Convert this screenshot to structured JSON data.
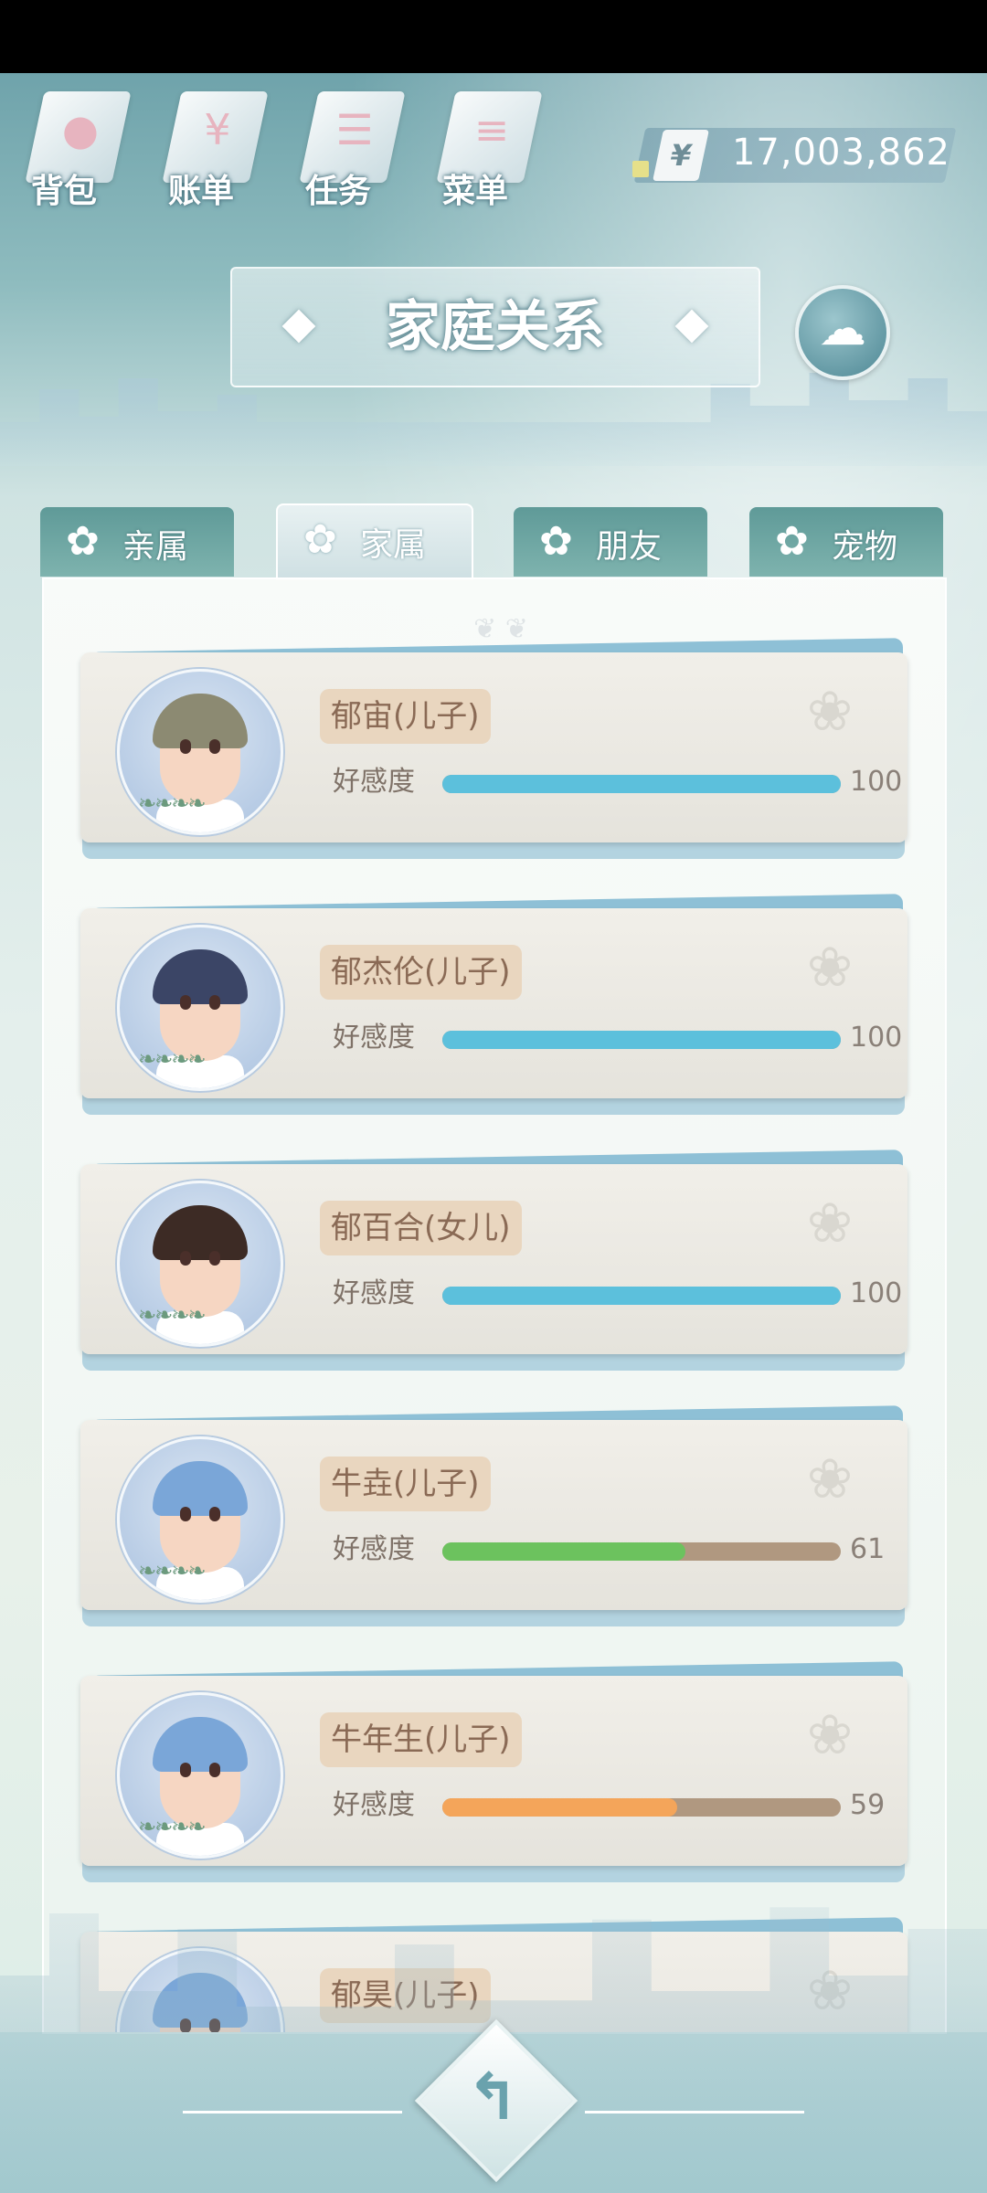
{
  "top_menu": [
    {
      "label": "背包",
      "icon": "backpack-icon",
      "glyph": "●"
    },
    {
      "label": "账单",
      "icon": "bill-icon",
      "glyph": "¥"
    },
    {
      "label": "任务",
      "icon": "task-icon",
      "glyph": "☰"
    },
    {
      "label": "菜单",
      "icon": "menu-icon",
      "glyph": "≡"
    }
  ],
  "money": {
    "symbol": "¥",
    "value": "17,003,862"
  },
  "title": "家庭关系",
  "tabs": [
    {
      "label": "亲属",
      "active": false
    },
    {
      "label": "家属",
      "active": true
    },
    {
      "label": "朋友",
      "active": false
    },
    {
      "label": "宠物",
      "active": false
    }
  ],
  "affection_label": "好感度",
  "members": [
    {
      "name": "郁宙(儿子)",
      "affection": 100,
      "max": 100,
      "bar_color": "#5cc0dc",
      "hair_color": "#8c8a72"
    },
    {
      "name": "郁杰伦(儿子)",
      "affection": 100,
      "max": 100,
      "bar_color": "#5cc0dc",
      "hair_color": "#3b4566"
    },
    {
      "name": "郁百合(女儿)",
      "affection": 100,
      "max": 100,
      "bar_color": "#5cc0dc",
      "hair_color": "#3d2b25"
    },
    {
      "name": "牛垚(儿子)",
      "affection": 61,
      "max": 100,
      "bar_color": "#6cc25e",
      "hair_color": "#7aa6d8"
    },
    {
      "name": "牛年生(儿子)",
      "affection": 59,
      "max": 100,
      "bar_color": "#f4a55a",
      "hair_color": "#7aa6d8"
    },
    {
      "name": "郁昊(儿子)",
      "affection": null,
      "max": 100,
      "bar_color": "#5cc0dc",
      "hair_color": "#7aa6d8"
    }
  ]
}
